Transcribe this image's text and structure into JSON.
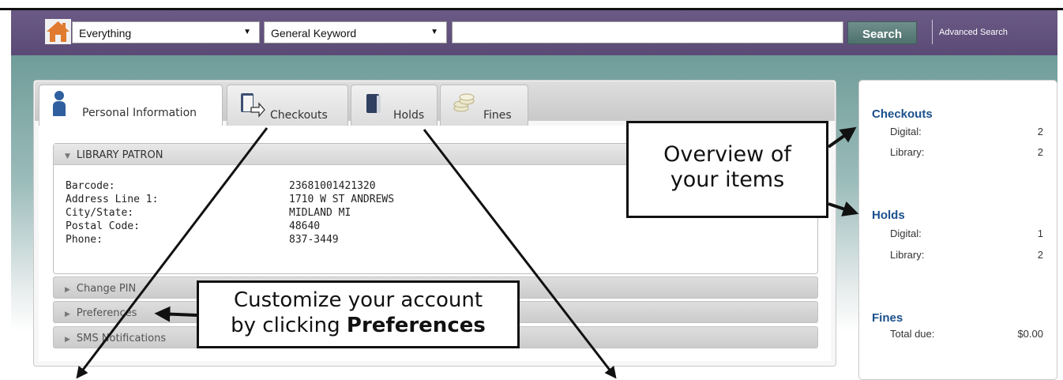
{
  "header": {
    "scope_select": "Everything",
    "field_select": "General Keyword",
    "search_query": "",
    "search_button": "Search",
    "advanced_search": "Advanced Search"
  },
  "tabs": [
    {
      "label": "Personal Information",
      "active": true
    },
    {
      "label": "Checkouts",
      "active": false
    },
    {
      "label": "Holds",
      "active": false
    },
    {
      "label": "Fines",
      "active": false
    }
  ],
  "library_patron": {
    "title": "LIBRARY PATRON",
    "fields": [
      {
        "label": "Barcode:",
        "value": "23681001421320"
      },
      {
        "label": "Address Line 1:",
        "value": "1710 W ST ANDREWS"
      },
      {
        "label": "City/State:",
        "value": "MIDLAND MI"
      },
      {
        "label": "Postal Code:",
        "value": "48640"
      },
      {
        "label": "Phone:",
        "value": "837-3449"
      }
    ]
  },
  "sections": [
    "Change PIN",
    "Preferences",
    "SMS Notifications"
  ],
  "summary": {
    "checkouts": {
      "title": "Checkouts",
      "digital_label": "Digital:",
      "digital": "2",
      "library_label": "Library:",
      "library": "2"
    },
    "holds": {
      "title": "Holds",
      "digital_label": "Digital:",
      "digital": "1",
      "library_label": "Library:",
      "library": "2"
    },
    "fines": {
      "title": "Fines",
      "total_label": "Total due:",
      "total": "$0.00"
    }
  },
  "callouts": {
    "overview_line1": "Overview of",
    "overview_line2": "your items",
    "prefs_line1": "Customize your account",
    "prefs_line2_prefix": "by clicking ",
    "prefs_line2_bold": "Preferences"
  },
  "colors": {
    "header": "#5f4f7b",
    "accent_blue": "#1b4f8c",
    "search_button": "#5f807d"
  },
  "icons": [
    "home-icon",
    "user-icon",
    "checkout-book-icon",
    "holds-book-icon",
    "fines-coins-icon",
    "dropdown-arrow-icon"
  ]
}
